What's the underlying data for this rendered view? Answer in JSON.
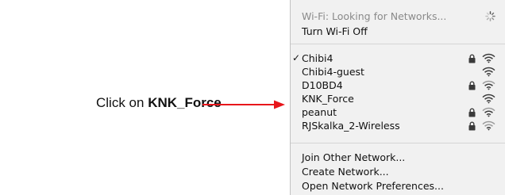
{
  "instruction": {
    "prefix": "Click on ",
    "target": "KNK_Force"
  },
  "wifi_menu": {
    "status": "Wi-Fi: Looking for Networks...",
    "toggle": "Turn Wi-Fi Off",
    "networks": [
      {
        "name": "Chibi4",
        "connected": true,
        "check": "✓",
        "locked": true
      },
      {
        "name": "Chibi4-guest",
        "connected": false,
        "check": "",
        "locked": false
      },
      {
        "name": "D10BD4",
        "connected": false,
        "check": "",
        "locked": true
      },
      {
        "name": "KNK_Force",
        "connected": false,
        "check": "",
        "locked": false
      },
      {
        "name": "peanut",
        "connected": false,
        "check": "",
        "locked": true
      },
      {
        "name": "RJSkalka_2-Wireless",
        "connected": false,
        "check": "",
        "locked": true
      }
    ],
    "actions": {
      "join_other": "Join Other Network...",
      "create": "Create Network...",
      "preferences": "Open Network Preferences..."
    }
  },
  "colors": {
    "arrow": "#e8161b",
    "menu_background": "#f1f1f1",
    "disabled_text": "#8a8a8a",
    "icon": "#3a3a3a"
  },
  "icons": {
    "status": "spinner-icon",
    "secured": "lock-icon",
    "signal": "wifi-icon"
  }
}
